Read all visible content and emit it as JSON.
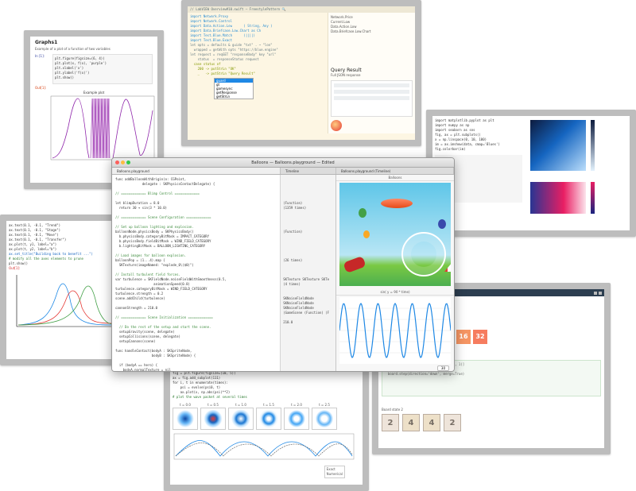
{
  "window1": {
    "title": "Graphs1",
    "subtitle": "Example of a plot of a function of two variables",
    "cell_in": "In [1]:",
    "cell_label": "Out[1]:",
    "chart_title": "Example plot"
  },
  "window2": {
    "header": "// LabVIEW Overview#10.swift — FreestylePattern 🔍",
    "side_title": "Query Result",
    "side_sub": "Full JSON response",
    "side_items": [
      "Network.Price",
      "Current.Low",
      "Data.Action.Low",
      "Data.Briefcase.Low.Chart"
    ],
    "code": [
      "import Network.Proxy",
      "import Network.Control",
      "import Data.Action.Low      ( String, Any )",
      "import Data.Briefcase.Low.Chart as Ch",
      "",
      "import Test.Blue.Match      (||||)",
      "import Test.Blue.Exact",
      "",
      "let opts = defaults & guide \"txt\" . ~ \"lon\"",
      "  wrapped = getWith opts \"https://blue.engine\"",
      "",
      "let request = reqGET \"responseBody\" key \"url\"",
      "    status  = responseStatus request",
      "  case status of",
      "    200 -> putStrLn \"OK\"",
      "    _   -> putStrLn \"Query Result\""
    ]
  },
  "window3": {
    "code": [
      "import matplotlib.pyplot as plt",
      "import numpy as np",
      "import seaborn as sns",
      "",
      "fig, ax = plt.subplots()",
      "x = np.linspace(0, 10, 100)",
      "im = ax.imshow(data, cmap='Blues')",
      "fig.colorbar(im)"
    ]
  },
  "window4": {
    "code": [
      "ax.text(0.1, -0.1, \"Trend\")",
      "ax.text(0.1, -0.1, \"Stage\")",
      "ax.text(0.1, -0.1, \"Move\")",
      "ax.text(0.1, -0.1, \"Transfer\")",
      "",
      "ax.plot(t, y1, label=\"a\")",
      "ax.plot(t, y2, label=\"b\")",
      "",
      "ax.set_title(\"Building back to benefit ...\")",
      "",
      "# modify all the axes elements to prune",
      "plt.show()"
    ],
    "prompt": "Out[1]:"
  },
  "window5": {
    "title": "Game of 2048",
    "tile_top_1": "16",
    "tile_top_2": "32",
    "row_label": "Board state 2",
    "tiles": [
      "2",
      "4",
      "4",
      "2"
    ]
  },
  "window6": {
    "code": [
      "fig = plt.figure(figsize=(10, 5))",
      "ax = fig.add_subplot(111)",
      "for i, t in enumerate(times):",
      "    psi = evolve(psi0, t)",
      "    ax.plot(x, np.abs(psi)**2)",
      "",
      "# plot the wave packet at several times"
    ],
    "panel_labels": [
      "t = 0.0",
      "t = 0.5",
      "t = 1.0",
      "t = 1.5",
      "t = 2.0",
      "t = 2.5"
    ],
    "legend": [
      "Exact",
      "Numerical"
    ]
  },
  "xcode": {
    "title": "Balloons — Balloons.playground — Edited",
    "tabs": [
      "Balloons.playground",
      "Timeline",
      "Balloons.playground (Timeline)"
    ],
    "scene_title": "Balloons",
    "graph_title": "sin( y = 90 * time)",
    "zoom": "30",
    "code": [
      {
        "t": "func addBalloonWithOrigin(o: CGPoint,",
        "c": ""
      },
      {
        "t": "              delegate : SKPhysicsContactDelegate) {",
        "c": ""
      },
      {
        "t": "",
        "c": ""
      },
      {
        "t": "// ============= Blimp Control =============",
        "c": "cm"
      },
      {
        "t": "",
        "c": ""
      },
      {
        "t": "let blimpDuration = 8.0",
        "c": ""
      },
      {
        "t": "  return 30 + sin(3 * 10.0)",
        "c": ""
      },
      {
        "t": "",
        "c": ""
      },
      {
        "t": "// ============= Scene Configuration =============",
        "c": "cm"
      },
      {
        "t": "",
        "c": ""
      },
      {
        "t": "// Set up balloon lighting and explosion.",
        "c": "cm"
      },
      {
        "t": "balloonNode.physicsBody = SKPhysicsBody()",
        "c": ""
      },
      {
        "t": "  b.physicsBody.categoryBitMask = IMPACT_CATEGORY",
        "c": ""
      },
      {
        "t": "  b.physicsBody.fieldBitMask = WIND_FIELD_CATEGORY",
        "c": ""
      },
      {
        "t": "  b.lightingBitMask = BALLOON_LIGHTING_CATEGORY",
        "c": ""
      },
      {
        "t": "",
        "c": ""
      },
      {
        "t": "// Load images for balloon explosion.",
        "c": "cm"
      },
      {
        "t": "balloonPop = (1...4).map {",
        "c": ""
      },
      {
        "t": "  SKTexture(imageNamed: \"explode_0\\($0)\")",
        "c": ""
      },
      {
        "t": "",
        "c": ""
      },
      {
        "t": "// Install turbulent field forces.",
        "c": "cm"
      },
      {
        "t": "var turbulence = SKFieldNode.noiseFieldWithSmoothness(0.5,",
        "c": ""
      },
      {
        "t": "                    animationSpeed(0.8)",
        "c": ""
      },
      {
        "t": "turbulence.categoryBitMask = WIND_FIELD_CATEGORY",
        "c": ""
      },
      {
        "t": "turbulence.strength = 0.2",
        "c": ""
      },
      {
        "t": "scene.addChild(turbulence)",
        "c": ""
      },
      {
        "t": "",
        "c": ""
      },
      {
        "t": "cannonStrength = 210.0",
        "c": ""
      },
      {
        "t": "",
        "c": ""
      },
      {
        "t": "// ============= Scene Initialization =============",
        "c": "cm"
      },
      {
        "t": "",
        "c": ""
      },
      {
        "t": "  // Do the rest of the setup and start the scene.",
        "c": "cm"
      },
      {
        "t": "  setupGravity(scene, delegate)",
        "c": ""
      },
      {
        "t": "  setupCollisions(scene, delegate)",
        "c": ""
      },
      {
        "t": "  setupCannons(scene)",
        "c": ""
      },
      {
        "t": "",
        "c": ""
      },
      {
        "t": "func handleContact(bodyA : SKSpriteNode,",
        "c": ""
      },
      {
        "t": "                   bodyB : SKSpriteNode) {",
        "c": ""
      },
      {
        "t": "",
        "c": ""
      },
      {
        "t": "  if (bodyA == hero) {",
        "c": ""
      },
      {
        "t": "    bodyA.normalTexture = nil",
        "c": ""
      },
      {
        "t": "    bodyA.runAction(removeBalloonAction)",
        "c": ""
      },
      {
        "t": "  } else if (bodyB == hero) {",
        "c": ""
      },
      {
        "t": "    bodyB.normalTexture = nil",
        "c": ""
      },
      {
        "t": "    bodyB.runAction(removeBalloonAction)",
        "c": ""
      },
      {
        "t": "  }",
        "c": ""
      }
    ],
    "results": [
      "",
      "",
      "",
      "",
      "",
      "(Function)",
      "(1359 times)",
      "",
      "",
      "",
      "",
      "(Function)",
      "",
      "",
      "",
      "",
      "",
      "(26 times)",
      "",
      "",
      "",
      "SKTexture SKTexture SKTe",
      "(4 times)",
      "",
      "",
      "SKNoiseFieldNode",
      "SKNoiseFieldNode",
      "SKNoiseFieldNode",
      "(GameScene (Function) (F",
      "",
      "210.0"
    ]
  }
}
